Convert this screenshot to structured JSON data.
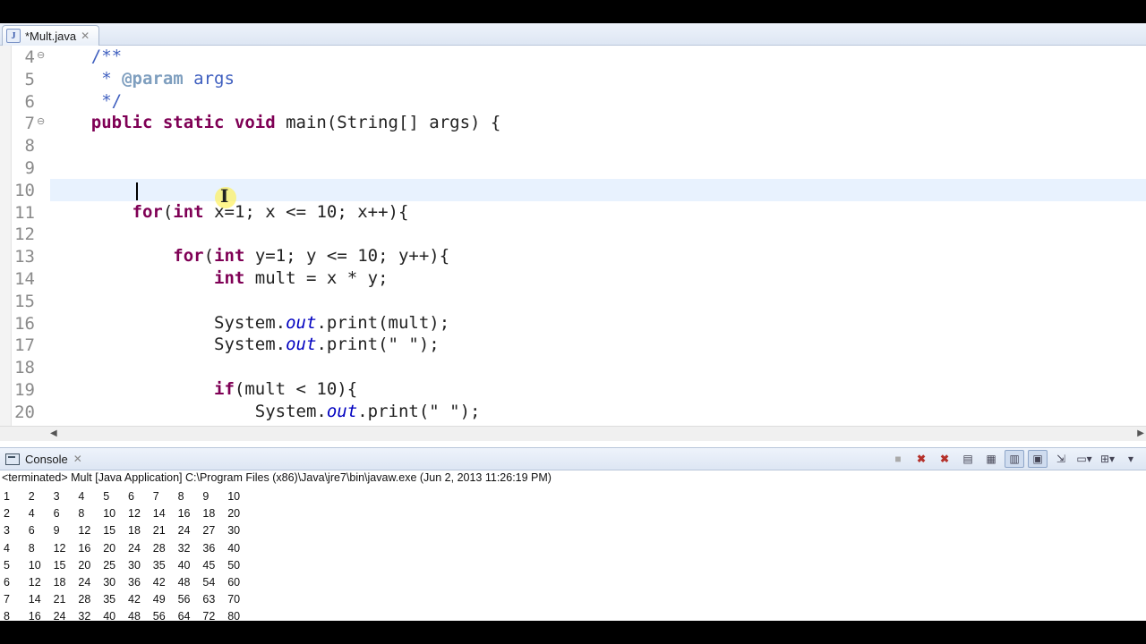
{
  "editor_tab": {
    "title": "*Mult.java",
    "icon": "java-file-icon"
  },
  "code_lines": [
    {
      "num": "4",
      "fold": "⊖",
      "tokens": [
        {
          "t": "    /**",
          "c": "cm"
        }
      ]
    },
    {
      "num": "5",
      "fold": "",
      "tokens": [
        {
          "t": "     * ",
          "c": "cm"
        },
        {
          "t": "@param",
          "c": "tag"
        },
        {
          "t": " args",
          "c": "cm"
        }
      ]
    },
    {
      "num": "6",
      "fold": "",
      "tokens": [
        {
          "t": "     */",
          "c": "cm"
        }
      ]
    },
    {
      "num": "7",
      "fold": "⊖",
      "tokens": [
        {
          "t": "    "
        },
        {
          "t": "public static void",
          "c": "kw"
        },
        {
          "t": " main(String[] args) {"
        }
      ]
    },
    {
      "num": "8",
      "fold": "",
      "tokens": []
    },
    {
      "num": "9",
      "fold": "",
      "tokens": []
    },
    {
      "num": "10",
      "fold": "",
      "tokens": [],
      "current": true
    },
    {
      "num": "11",
      "fold": "",
      "tokens": [
        {
          "t": "        "
        },
        {
          "t": "for",
          "c": "kw"
        },
        {
          "t": "("
        },
        {
          "t": "int",
          "c": "kw"
        },
        {
          "t": " x=1; x <= 10; x++){"
        }
      ]
    },
    {
      "num": "12",
      "fold": "",
      "tokens": []
    },
    {
      "num": "13",
      "fold": "",
      "tokens": [
        {
          "t": "            "
        },
        {
          "t": "for",
          "c": "kw"
        },
        {
          "t": "("
        },
        {
          "t": "int",
          "c": "kw"
        },
        {
          "t": " y=1; y <= 10; y++){"
        }
      ]
    },
    {
      "num": "14",
      "fold": "",
      "tokens": [
        {
          "t": "                "
        },
        {
          "t": "int",
          "c": "kw"
        },
        {
          "t": " mult = x * y;"
        }
      ]
    },
    {
      "num": "15",
      "fold": "",
      "tokens": []
    },
    {
      "num": "16",
      "fold": "",
      "tokens": [
        {
          "t": "                System."
        },
        {
          "t": "out",
          "c": "fld"
        },
        {
          "t": ".print(mult);"
        }
      ]
    },
    {
      "num": "17",
      "fold": "",
      "tokens": [
        {
          "t": "                System."
        },
        {
          "t": "out",
          "c": "fld"
        },
        {
          "t": ".print(\" \");"
        }
      ]
    },
    {
      "num": "18",
      "fold": "",
      "tokens": []
    },
    {
      "num": "19",
      "fold": "",
      "tokens": [
        {
          "t": "                "
        },
        {
          "t": "if",
          "c": "kw"
        },
        {
          "t": "(mult < 10){"
        }
      ]
    },
    {
      "num": "20",
      "fold": "",
      "tokens": [
        {
          "t": "                    System."
        },
        {
          "t": "out",
          "c": "fld"
        },
        {
          "t": ".print(\" \");"
        }
      ]
    }
  ],
  "console": {
    "tab_label": "Console",
    "status": "<terminated> Mult [Java Application] C:\\Program Files (x86)\\Java\\jre7\\bin\\javaw.exe (Jun 2, 2013 11:26:19 PM)",
    "toolbar": [
      "terminate-icon",
      "remove-launch-icon",
      "remove-all-launches-icon",
      "clear-console-icon",
      "scroll-lock-icon",
      "word-wrap-icon",
      "show-when-stdout-icon",
      "pin-console-icon",
      "display-console-icon",
      "open-console-icon"
    ],
    "output": [
      [
        "1",
        "2",
        "3",
        "4",
        "5",
        "6",
        "7",
        "8",
        "9",
        "10"
      ],
      [
        "2",
        "4",
        "6",
        "8",
        "10",
        "12",
        "14",
        "16",
        "18",
        "20"
      ],
      [
        "3",
        "6",
        "9",
        "12",
        "15",
        "18",
        "21",
        "24",
        "27",
        "30"
      ],
      [
        "4",
        "8",
        "12",
        "16",
        "20",
        "24",
        "28",
        "32",
        "36",
        "40"
      ],
      [
        "5",
        "10",
        "15",
        "20",
        "25",
        "30",
        "35",
        "40",
        "45",
        "50"
      ],
      [
        "6",
        "12",
        "18",
        "24",
        "30",
        "36",
        "42",
        "48",
        "54",
        "60"
      ],
      [
        "7",
        "14",
        "21",
        "28",
        "35",
        "42",
        "49",
        "56",
        "63",
        "70"
      ],
      [
        "8",
        "16",
        "24",
        "32",
        "40",
        "48",
        "56",
        "64",
        "72",
        "80"
      ]
    ]
  }
}
